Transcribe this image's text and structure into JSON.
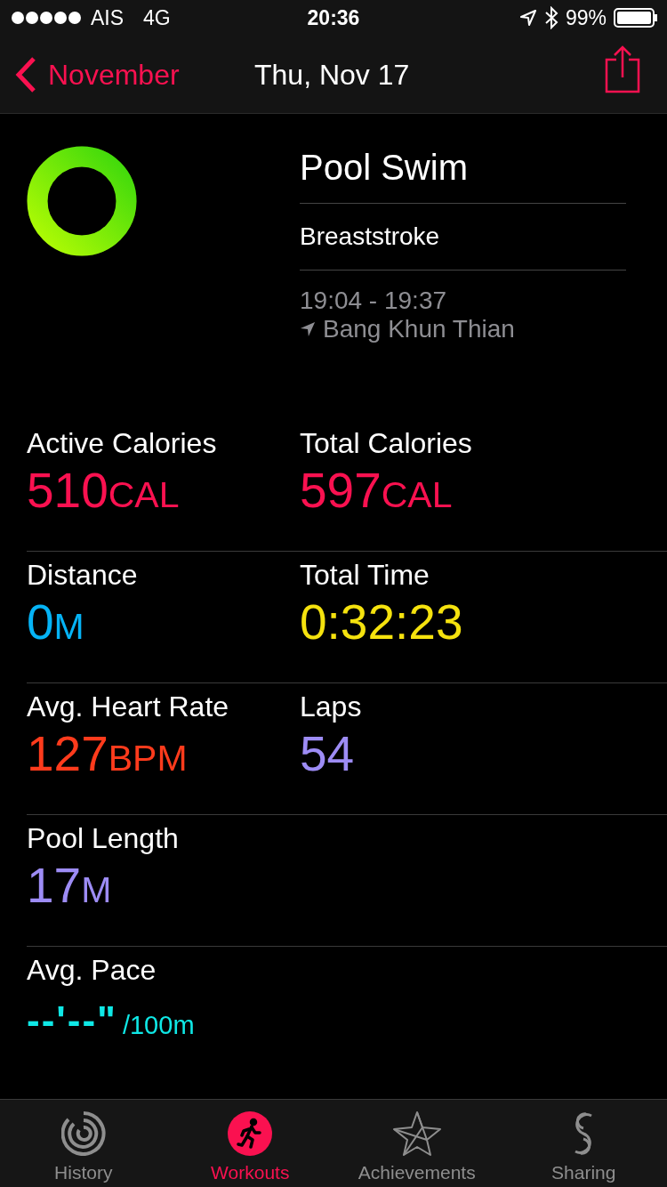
{
  "status_bar": {
    "carrier": "AIS",
    "network": "4G",
    "time": "20:36",
    "battery": "99%"
  },
  "nav": {
    "back": "November",
    "title": "Thu, Nov 17"
  },
  "workout": {
    "name": "Pool Swim",
    "stroke": "Breaststroke",
    "time_range": "19:04 - 19:37",
    "location": "Bang Khun Thian"
  },
  "metrics": [
    [
      {
        "kind": "measure",
        "label": "Active Calories",
        "value": "510",
        "unit": "CAL",
        "color": "#fa1150"
      },
      {
        "kind": "measure",
        "label": "Total Calories",
        "value": "597",
        "unit": "CAL",
        "color": "#fa1150"
      }
    ],
    [
      {
        "kind": "measure",
        "label": "Distance",
        "value": "0",
        "unit": "M",
        "color": "#05b3f5"
      },
      {
        "kind": "measure",
        "label": "Total Time",
        "value": "0:32:23",
        "color": "#f5e20e"
      }
    ],
    [
      {
        "kind": "measure",
        "label": "Avg. Heart Rate",
        "value": "127",
        "unit": "BPM",
        "color": "#ff3b1c"
      },
      {
        "kind": "measure",
        "label": "Laps",
        "value": "54",
        "color": "#9d8cf5"
      }
    ],
    [
      {
        "kind": "measure",
        "label": "Pool Length",
        "value": "17",
        "unit": "M",
        "color": "#9d8cf5"
      }
    ],
    [
      {
        "kind": "pace",
        "label": "Avg. Pace",
        "value": "--'--\"",
        "unit": "/100m",
        "color": "#0fe8e6"
      }
    ]
  ],
  "tabs": [
    {
      "label": "History",
      "selected": false
    },
    {
      "label": "Workouts",
      "selected": true
    },
    {
      "label": "Achievements",
      "selected": false
    },
    {
      "label": "Sharing",
      "selected": false
    }
  ]
}
